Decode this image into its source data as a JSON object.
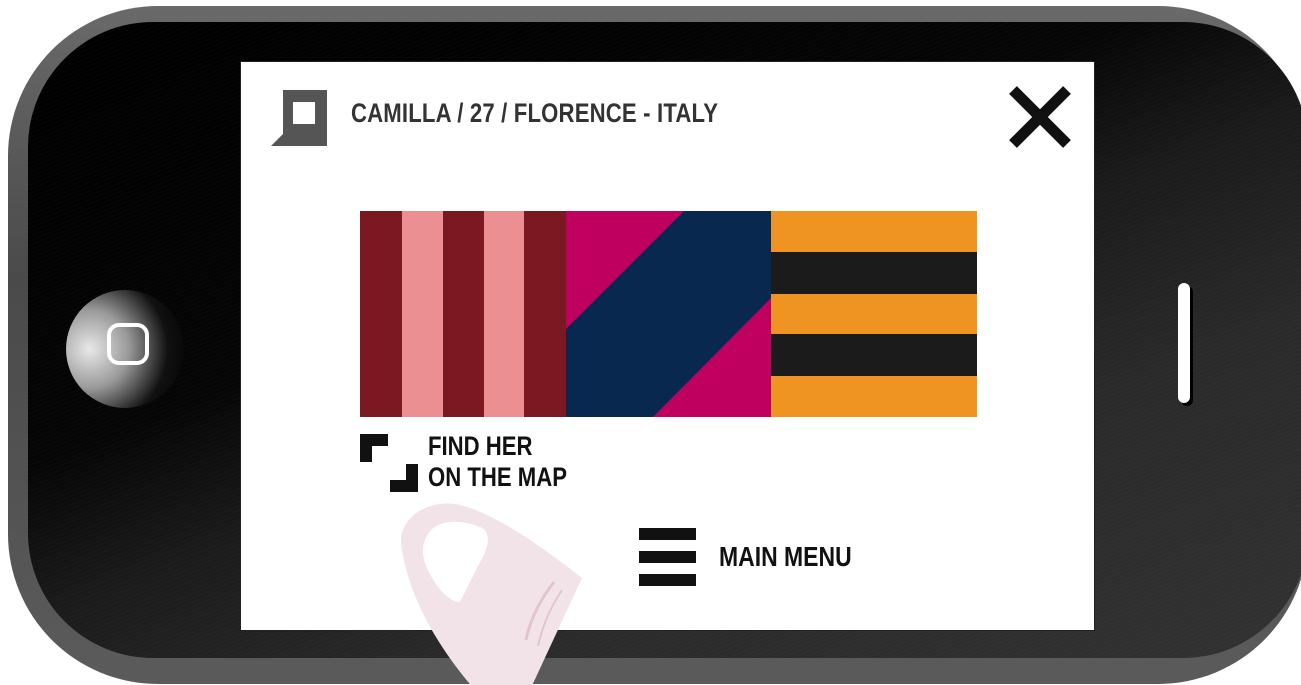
{
  "device": {
    "frame_color": "#555555",
    "home_button_icon": "rounded-square-icon"
  },
  "header": {
    "title": "CAMILLA / 27 / FLORENCE - ITALY",
    "profile_icon": "speech-bubble-square-icon",
    "close_icon": "close-x-icon"
  },
  "flag": {
    "colors": {
      "maroon": "#7b1822",
      "pink": "#ec8f92",
      "magenta": "#c0005f",
      "navy": "#082850",
      "orange": "#ef9423",
      "black": "#1b1b1b"
    }
  },
  "map_link": {
    "icon": "map-corners-icon",
    "line1": "FIND HER",
    "line2": "ON THE MAP"
  },
  "main_menu": {
    "icon": "hamburger-menu-icon",
    "label": "MAIN MENU"
  },
  "gesture": {
    "icon": "finger-tap-icon"
  }
}
